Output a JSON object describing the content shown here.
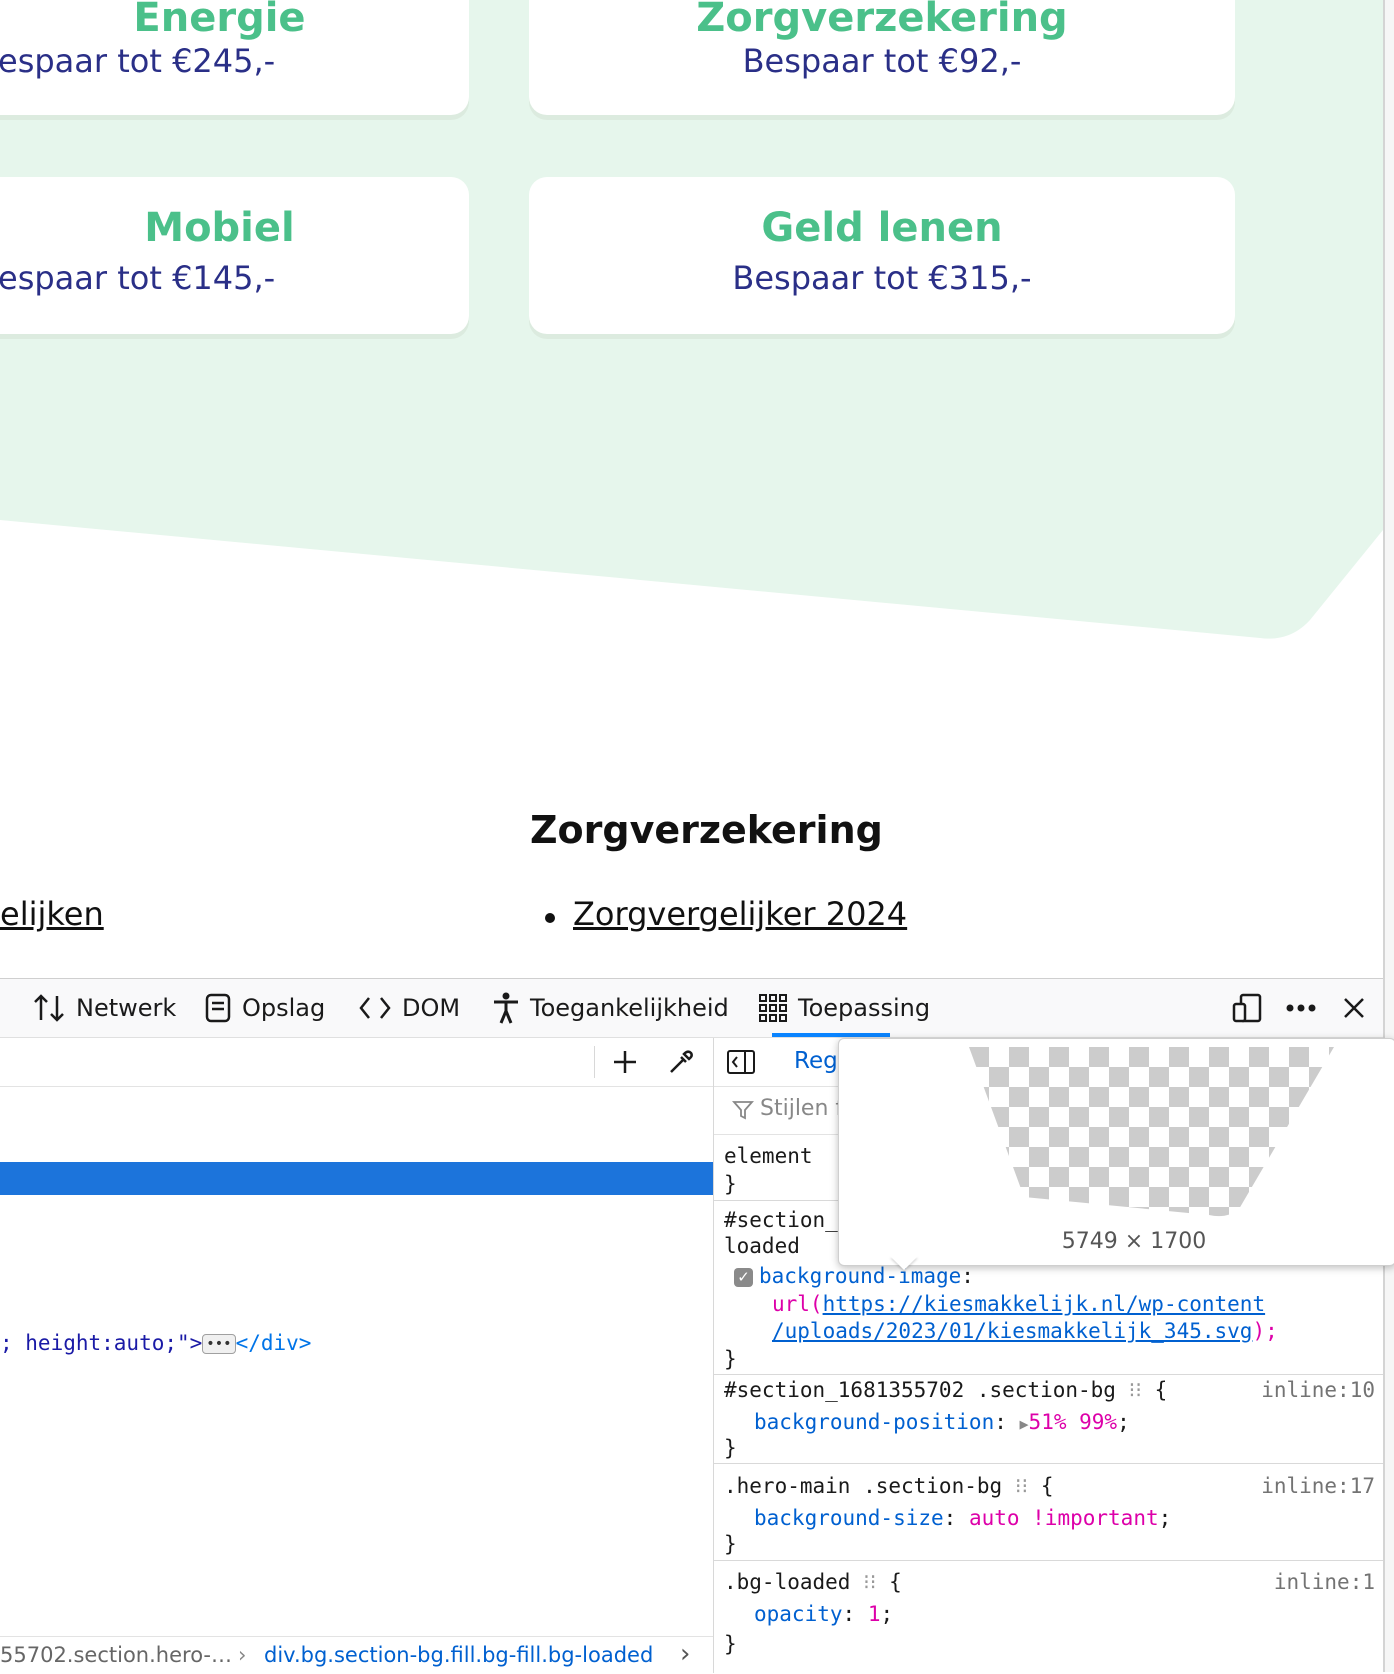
{
  "page": {
    "cards": [
      {
        "title": "Energie",
        "subtitle": "espaar tot €245,-"
      },
      {
        "title": "Zorgverzekering",
        "subtitle": "Bespaar tot €92,-"
      },
      {
        "title": "Mobiel",
        "subtitle": "espaar tot €145,-"
      },
      {
        "title": "Geld lenen",
        "subtitle": "Bespaar tot €315,-"
      }
    ],
    "section_title": "Zorgverzekering",
    "left_link": "elijken",
    "right_link": "Zorgvergelijker 2024"
  },
  "devtools": {
    "tabs": [
      {
        "label": "Netwerk",
        "icon": "network-icon"
      },
      {
        "label": "Opslag",
        "icon": "storage-icon"
      },
      {
        "label": "DOM",
        "icon": "dom-icon"
      },
      {
        "label": "Toegankelijkheid",
        "icon": "accessibility-icon"
      },
      {
        "label": "Toepassing",
        "icon": "application-icon"
      }
    ],
    "inspector": {
      "code_line": "; height:auto;\">",
      "close_tag": "</div>",
      "breadcrumb_left": "55702.section.hero-…",
      "breadcrumb_right": "div.bg.section-bg.fill.bg-fill.bg-loaded"
    },
    "rules": {
      "tab_label": "Reg",
      "filter_placeholder": "Stijlen f",
      "element_selector": "element",
      "section_selector_1": "#section_",
      "section_selector_1b": "loaded",
      "bg_image_prop": "background-image",
      "url_fn": "url(",
      "url_part1": "https://kiesmakkelijk.nl/wp-content",
      "url_part2": "/uploads/2023/01/kiesmakkelijk_345.svg",
      "url_end": ");",
      "rule2_selector": "#section_1681355702 .section-bg",
      "rule2_prop": "background-position",
      "rule2_val": "51% 99%",
      "rule2_src": "inline:10",
      "rule3_selector": ".hero-main .section-bg",
      "rule3_prop": "background-size",
      "rule3_val": "auto !important",
      "rule3_src": "inline:17",
      "rule4_selector": ".bg-loaded",
      "rule4_prop": "opacity",
      "rule4_val": "1",
      "rule4_src": "inline:1"
    },
    "tooltip": {
      "dimensions": "5749 × 1700"
    }
  },
  "colors": {
    "hero_bg": "#e6f6ec",
    "card_title": "#4bc08a",
    "card_subtitle": "#2a2f87",
    "selection": "#1c74db",
    "tab_active": "#0a84ff"
  }
}
